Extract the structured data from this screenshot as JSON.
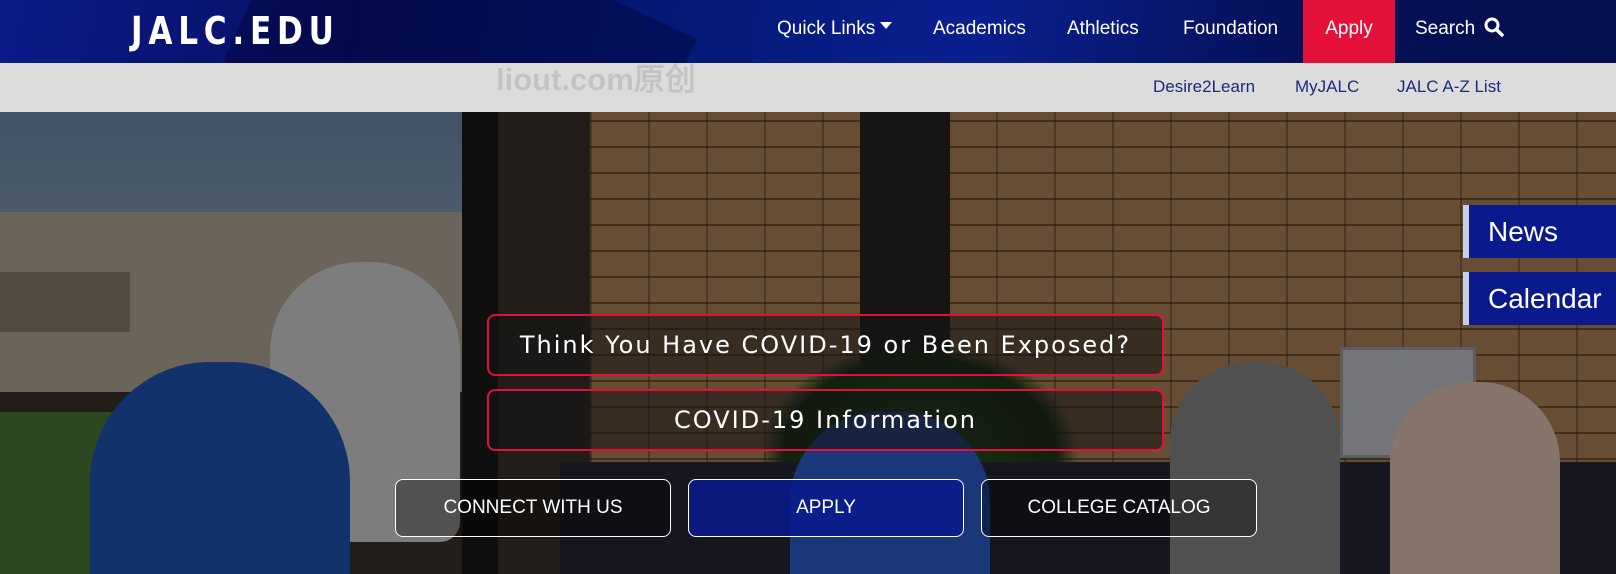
{
  "header": {
    "logo": "JALC.EDU",
    "nav": {
      "quick_links": "Quick Links",
      "academics": "Academics",
      "athletics": "Athletics",
      "foundation": "Foundation",
      "apply": "Apply",
      "search": "Search"
    },
    "colors": {
      "nav_bg": "#061060",
      "apply_bg": "#e4103a"
    }
  },
  "subnav": {
    "items": [
      "Desire2Learn",
      "MyJALC",
      "JALC A-Z List"
    ],
    "watermark": "liout.com原创"
  },
  "hero": {
    "side_tabs": [
      "News",
      "Calendar"
    ],
    "covid_buttons": [
      "Think You Have COVID-19 or Been Exposed?",
      "COVID-19 Information"
    ],
    "cta_buttons": [
      "CONNECT WITH US",
      "APPLY",
      "COLLEGE CATALOG"
    ],
    "colors": {
      "covid_border": "#e4103a",
      "tab_bg": "#0a1a8c"
    }
  }
}
